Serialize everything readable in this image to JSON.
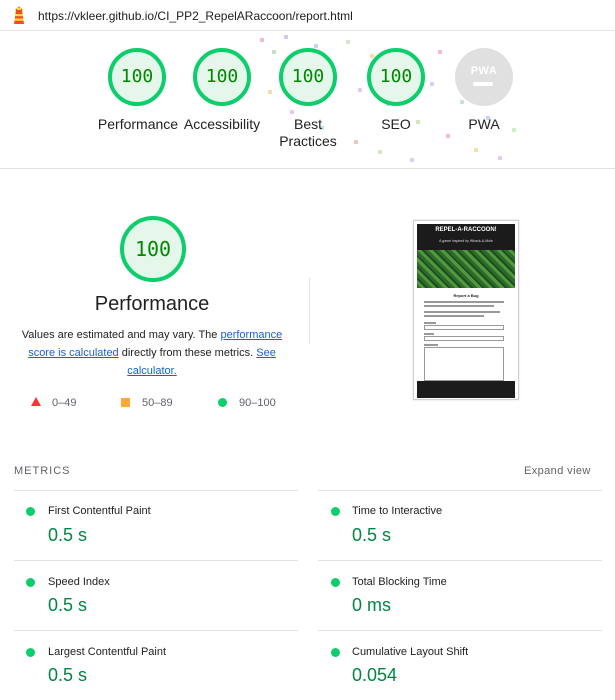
{
  "url": "https://vkleer.github.io/CI_PP2_RepelARaccoon/report.html",
  "gauges": [
    {
      "label": "Performance",
      "score": "100"
    },
    {
      "label": "Accessibility",
      "score": "100"
    },
    {
      "label": "Best Practices",
      "score": "100"
    },
    {
      "label": "SEO",
      "score": "100"
    },
    {
      "label": "PWA",
      "score": ""
    }
  ],
  "pwa_badge": "PWA",
  "performance": {
    "score": "100",
    "title": "Performance",
    "desc_pre": "Values are estimated and may vary. The ",
    "desc_link1": "performance score is calculated",
    "desc_mid": " directly from these metrics. ",
    "desc_link2": "See calculator."
  },
  "legend": [
    {
      "range": "0–49",
      "color": "#ff3333"
    },
    {
      "range": "50–89",
      "color": "#ffaa33"
    },
    {
      "range": "90–100",
      "color": "#0cce6b"
    }
  ],
  "thumbnail": {
    "title": "REPEL-A-RACCOON!",
    "subtitle": "A game inspired by Whack-A-Mole",
    "card_heading": "Report a Bug"
  },
  "metrics": {
    "heading": "METRICS",
    "expand_label": "Expand view",
    "items": [
      {
        "name": "First Contentful Paint",
        "value": "0.5 s"
      },
      {
        "name": "Time to Interactive",
        "value": "0.5 s"
      },
      {
        "name": "Speed Index",
        "value": "0.5 s"
      },
      {
        "name": "Total Blocking Time",
        "value": "0 ms"
      },
      {
        "name": "Largest Contentful Paint",
        "value": "0.5 s"
      },
      {
        "name": "Cumulative Layout Shift",
        "value": "0.054"
      }
    ]
  },
  "colors": {
    "pass": "#0cce6b",
    "pass_bg": "#e5f7ea",
    "score_text": "#008800",
    "metric_value": "#018642",
    "link": "#1a5fd6"
  }
}
